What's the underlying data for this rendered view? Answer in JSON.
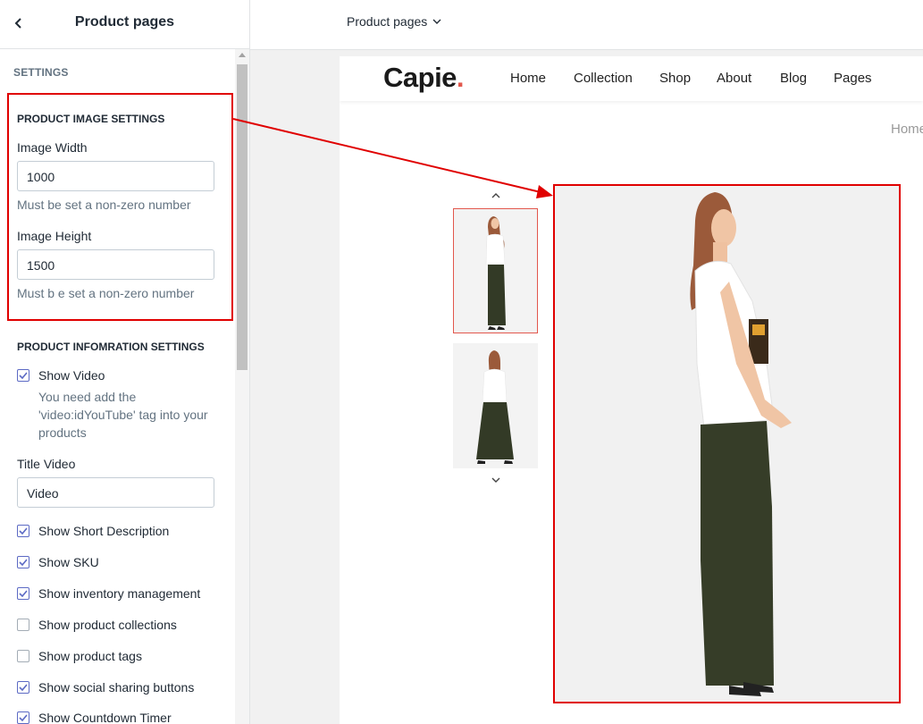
{
  "sidebar": {
    "title": "Product pages",
    "section_label": "SETTINGS",
    "image_settings": {
      "title": "PRODUCT IMAGE SETTINGS",
      "width_label": "Image Width",
      "width_value": "1000",
      "width_help": "Must be set a non-zero number",
      "height_label": "Image Height",
      "height_value": "1500",
      "height_help": "Must b e set a non-zero number"
    },
    "info_settings": {
      "title": "PRODUCT INFOMRATION SETTINGS",
      "show_video_label": "Show Video",
      "show_video_checked": true,
      "video_help_1": "You need add the",
      "video_help_2": "'video:idYouTube' tag into your",
      "video_help_3": "products",
      "title_video_label": "Title Video",
      "title_video_value": "Video",
      "options": [
        {
          "label": "Show Short Description",
          "checked": true
        },
        {
          "label": "Show SKU",
          "checked": true
        },
        {
          "label": "Show inventory management",
          "checked": true
        },
        {
          "label": "Show product collections",
          "checked": false
        },
        {
          "label": "Show product tags",
          "checked": false
        },
        {
          "label": "Show social sharing buttons",
          "checked": true
        },
        {
          "label": "Show Countdown Timer",
          "checked": true
        }
      ]
    }
  },
  "topbar": {
    "page_select": "Product pages"
  },
  "store": {
    "logo": "Capie",
    "logo_dot": ".",
    "nav": [
      "Home",
      "Collection",
      "Shop",
      "About",
      "Blog",
      "Pages"
    ],
    "breadcrumb": "Home"
  },
  "colors": {
    "highlight": "#e00000",
    "accent": "#5c6ac4",
    "logo_dot": "#e2574c"
  }
}
